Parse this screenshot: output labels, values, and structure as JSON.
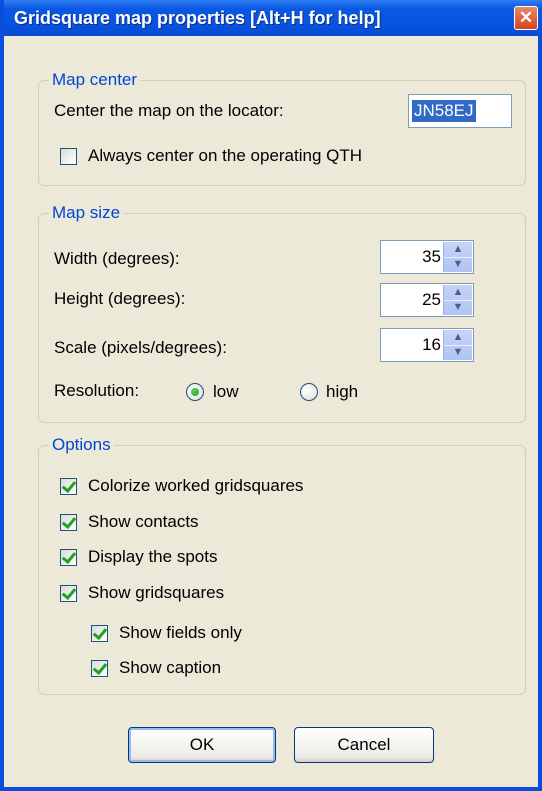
{
  "window": {
    "title": "Gridsquare map properties [Alt+H for help]",
    "close_glyph": "✕"
  },
  "map_center": {
    "legend": "Map center",
    "locator_label": "Center the map on the locator:",
    "locator_value": "JN58EJ",
    "always_center_label": "Always center on the operating QTH",
    "always_center_checked": false
  },
  "map_size": {
    "legend": "Map size",
    "width_label": "Width (degrees):",
    "width_value": "35",
    "height_label": "Height (degrees):",
    "height_value": "25",
    "scale_label": "Scale (pixels/degrees):",
    "scale_value": "16",
    "resolution_label": "Resolution:",
    "resolution_low": "low",
    "resolution_high": "high",
    "resolution_selected": "low"
  },
  "options": {
    "legend": "Options",
    "colorize_label": "Colorize worked gridsquares",
    "show_contacts_label": "Show contacts",
    "display_spots_label": "Display the spots",
    "show_gridsquares_label": "Show gridsquares",
    "show_fields_only_label": "Show fields only",
    "show_caption_label": "Show caption"
  },
  "buttons": {
    "ok": "OK",
    "cancel": "Cancel"
  },
  "icons": {
    "spin_up": "▲",
    "spin_down": "▼"
  },
  "colors": {
    "titlebar": "#0553e0",
    "legend_text": "#0046d5",
    "check_mark": "#21a121",
    "selection": "#316ac5"
  }
}
